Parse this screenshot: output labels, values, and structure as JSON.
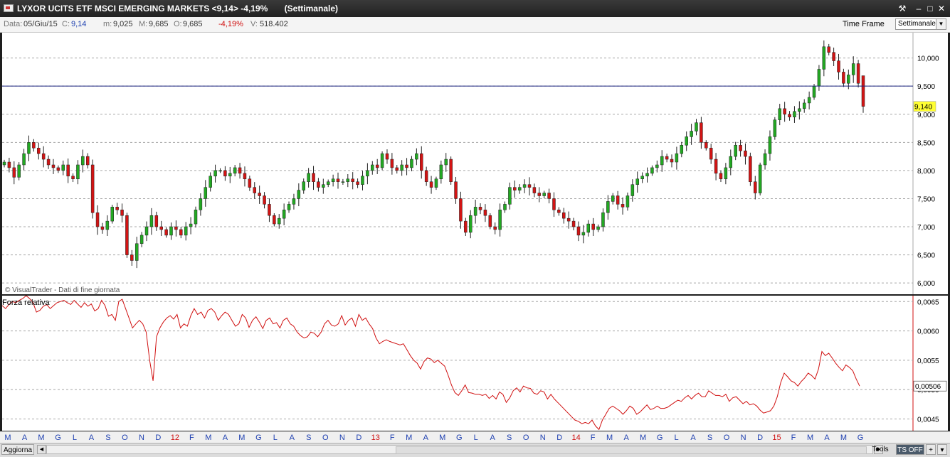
{
  "window": {
    "title": "LYXOR UCITS ETF MSCI EMERGING MARKETS <9,14> -4,19%       (Settimanale)",
    "controls": [
      "⚒",
      "–",
      "□",
      "✕"
    ]
  },
  "info": {
    "date_label": "Data:",
    "date_value": "05/Giu/15",
    "c_label": "C:",
    "c_value": "9,14",
    "m_label": "m:",
    "m_value": "9,025",
    "M_label": "M:",
    "M_value": "9,685",
    "o_label": "O:",
    "o_value": "9,685",
    "change_value": "-4,19%",
    "v_label": "V:",
    "v_value": "518.402",
    "time_frame_label": "Time Frame",
    "time_frame_value": "Settimanale"
  },
  "copyright": "© VisualTrader - Dati di fine giornata",
  "price_panel": {
    "current_price_tag": "9,140",
    "reference_line": 9.5,
    "colors": {
      "up": "#22a822",
      "down": "#d21414",
      "reference_line": "#1a237e",
      "tag_bg": "#ffff33"
    }
  },
  "indicator_panel": {
    "title": "Forza relativa",
    "current_value_tag": "0,00506",
    "colors": {
      "line": "#d01010"
    }
  },
  "status_bar": {
    "refresh_button": "Aggiorna",
    "tools_button": "Tools",
    "ts_button": "TS OFF",
    "plus_button": "+",
    "menu_button": "▾"
  },
  "chart_data": [
    {
      "type": "candlestick",
      "title": "LYXOR UCITS ETF MSCI EMERGING MARKETS",
      "ylim": [
        5.8,
        10.45
      ],
      "y_ticks": [
        6.0,
        6.5,
        7.0,
        7.5,
        8.0,
        8.5,
        9.0,
        9.5,
        10.0
      ],
      "y_tick_labels": [
        "6,000",
        "6,500",
        "7,000",
        "7,500",
        "8,000",
        "8,500",
        "9,000",
        "9,500",
        "10,000"
      ],
      "grid": "horizontal dashed",
      "x_tick_labels": [
        "M",
        "A",
        "M",
        "G",
        "L",
        "A",
        "S",
        "O",
        "N",
        "D",
        "12",
        "F",
        "M",
        "A",
        "M",
        "G",
        "L",
        "A",
        "S",
        "O",
        "N",
        "D",
        "13",
        "F",
        "M",
        "A",
        "M",
        "G",
        "L",
        "A",
        "S",
        "O",
        "N",
        "D",
        "14",
        "F",
        "M",
        "A",
        "M",
        "G",
        "L",
        "A",
        "S",
        "O",
        "N",
        "D",
        "15",
        "F",
        "M",
        "A",
        "M",
        "G"
      ],
      "x_year_labels": [
        "12",
        "13",
        "14",
        "15"
      ],
      "weekly_close": [
        8.15,
        8.05,
        7.88,
        8.1,
        8.3,
        8.5,
        8.4,
        8.3,
        8.2,
        8.1,
        8.05,
        8.0,
        8.1,
        7.9,
        7.85,
        8.1,
        8.25,
        8.1,
        7.25,
        7.0,
        6.95,
        7.1,
        7.35,
        7.3,
        7.2,
        6.5,
        6.4,
        6.7,
        6.85,
        7.0,
        7.2,
        7.0,
        6.95,
        6.85,
        7.0,
        6.95,
        6.85,
        7.0,
        7.05,
        7.3,
        7.5,
        7.7,
        7.9,
        8.0,
        8.0,
        7.9,
        7.95,
        8.05,
        7.95,
        7.85,
        7.7,
        7.6,
        7.55,
        7.4,
        7.2,
        7.05,
        7.15,
        7.3,
        7.4,
        7.5,
        7.65,
        7.8,
        7.95,
        7.8,
        7.7,
        7.75,
        7.8,
        7.85,
        7.8,
        7.8,
        7.85,
        7.8,
        7.75,
        7.9,
        8.0,
        8.1,
        8.05,
        8.3,
        8.2,
        8.05,
        8.0,
        8.1,
        8.05,
        8.2,
        8.3,
        8.0,
        7.8,
        7.7,
        7.85,
        8.1,
        8.2,
        7.8,
        7.5,
        7.1,
        6.9,
        7.2,
        7.35,
        7.3,
        7.2,
        7.0,
        6.95,
        7.3,
        7.4,
        7.7,
        7.65,
        7.7,
        7.75,
        7.7,
        7.6,
        7.55,
        7.6,
        7.5,
        7.3,
        7.25,
        7.15,
        7.1,
        7.0,
        6.85,
        6.9,
        7.05,
        6.95,
        7.0,
        7.25,
        7.45,
        7.55,
        7.4,
        7.35,
        7.55,
        7.75,
        7.85,
        7.9,
        7.95,
        8.05,
        8.1,
        8.25,
        8.2,
        8.15,
        8.3,
        8.45,
        8.6,
        8.7,
        8.85,
        8.5,
        8.4,
        8.2,
        7.95,
        7.85,
        8.05,
        8.25,
        8.45,
        8.35,
        8.25,
        7.8,
        7.6,
        8.1,
        8.3,
        8.6,
        8.9,
        9.1,
        9.0,
        8.95,
        9.05,
        9.1,
        9.2,
        9.3,
        9.5,
        9.8,
        10.2,
        10.1,
        9.95,
        9.75,
        9.55,
        9.7,
        9.9,
        9.55,
        9.14
      ],
      "last_candle": {
        "open": 9.685,
        "high": 9.685,
        "low": 9.025,
        "close": 9.14
      }
    },
    {
      "type": "line",
      "title": "Forza relativa",
      "ylim": [
        0.0043,
        0.0066
      ],
      "y_ticks": [
        0.0045,
        0.005,
        0.0055,
        0.006,
        0.0065
      ],
      "y_tick_labels": [
        "0,0045",
        "0,0050",
        "0,0055",
        "0,0060",
        "0,0065"
      ],
      "values": [
        0.00643,
        0.00638,
        0.00645,
        0.0065,
        0.00648,
        0.00652,
        0.00655,
        0.0066,
        0.00655,
        0.00648,
        0.00632,
        0.00635,
        0.00642,
        0.00645,
        0.00638,
        0.00643,
        0.00648,
        0.0065,
        0.00652,
        0.00648,
        0.00645,
        0.00652,
        0.00646,
        0.0064,
        0.00648,
        0.00642,
        0.00646,
        0.00634,
        0.00638,
        0.00652,
        0.00643,
        0.00625,
        0.00628,
        0.00618,
        0.0065,
        0.00654,
        0.00638,
        0.00622,
        0.00605,
        0.00612,
        0.00618,
        0.00612,
        0.00598,
        0.0055,
        0.00515,
        0.0059,
        0.00605,
        0.00615,
        0.00622,
        0.00626,
        0.0062,
        0.00628,
        0.00605,
        0.00612,
        0.00608,
        0.00626,
        0.00638,
        0.00628,
        0.00632,
        0.00622,
        0.00635,
        0.00638,
        0.00632,
        0.00618,
        0.00626,
        0.00632,
        0.00628,
        0.00618,
        0.00608,
        0.00612,
        0.00628,
        0.00622,
        0.00606,
        0.00618,
        0.00624,
        0.00615,
        0.00604,
        0.00618,
        0.00622,
        0.00612,
        0.00614,
        0.00605,
        0.00618,
        0.00622,
        0.00612,
        0.00608,
        0.00598,
        0.00592,
        0.00588,
        0.0059,
        0.00598,
        0.00596,
        0.0059,
        0.00598,
        0.00612,
        0.00618,
        0.0061,
        0.00608,
        0.00612,
        0.00626,
        0.0061,
        0.00618,
        0.00622,
        0.00608,
        0.00628,
        0.00618,
        0.00622,
        0.00612,
        0.00604,
        0.00588,
        0.00578,
        0.00582,
        0.00585,
        0.00582,
        0.0058,
        0.00578,
        0.00576,
        0.00578,
        0.00568,
        0.00558,
        0.0055,
        0.00545,
        0.00535,
        0.00548,
        0.00554,
        0.00552,
        0.00546,
        0.0055,
        0.00545,
        0.0054,
        0.00525,
        0.00508,
        0.00495,
        0.0049,
        0.00498,
        0.00508,
        0.00495,
        0.00494,
        0.00492,
        0.00492,
        0.0049,
        0.00492,
        0.00485,
        0.0049,
        0.00484,
        0.00496,
        0.00492,
        0.00478,
        0.00486,
        0.00498,
        0.00503,
        0.00496,
        0.00506,
        0.00503,
        0.00502,
        0.00494,
        0.00492,
        0.00498,
        0.00496,
        0.00484,
        0.00492,
        0.00484,
        0.00478,
        0.00472,
        0.00466,
        0.0046,
        0.00454,
        0.00448,
        0.00446,
        0.00442,
        0.00444,
        0.00442,
        0.00448,
        0.00438,
        0.00432,
        0.00448,
        0.00458,
        0.00468,
        0.00472,
        0.00468,
        0.00464,
        0.00458,
        0.00464,
        0.00472,
        0.00468,
        0.00458,
        0.00462,
        0.00468,
        0.00474,
        0.00466,
        0.00468,
        0.00472,
        0.00468,
        0.00468,
        0.0047,
        0.00474,
        0.00478,
        0.00482,
        0.0048,
        0.00486,
        0.0049,
        0.00484,
        0.0049,
        0.00494,
        0.00488,
        0.00488,
        0.00498,
        0.00494,
        0.0049,
        0.0049,
        0.00488,
        0.00492,
        0.0048,
        0.00486,
        0.00488,
        0.00482,
        0.00476,
        0.0048,
        0.00474,
        0.00476,
        0.00472,
        0.00465,
        0.0046,
        0.00462,
        0.00464,
        0.00472,
        0.00488,
        0.00512,
        0.00528,
        0.00522,
        0.00515,
        0.00512,
        0.00506,
        0.00514,
        0.0052,
        0.00528,
        0.00524,
        0.00518,
        0.00535,
        0.00565,
        0.00558,
        0.00562,
        0.00554,
        0.00545,
        0.00538,
        0.00532,
        0.00542,
        0.00538,
        0.00532,
        0.00518,
        0.00506
      ]
    }
  ]
}
